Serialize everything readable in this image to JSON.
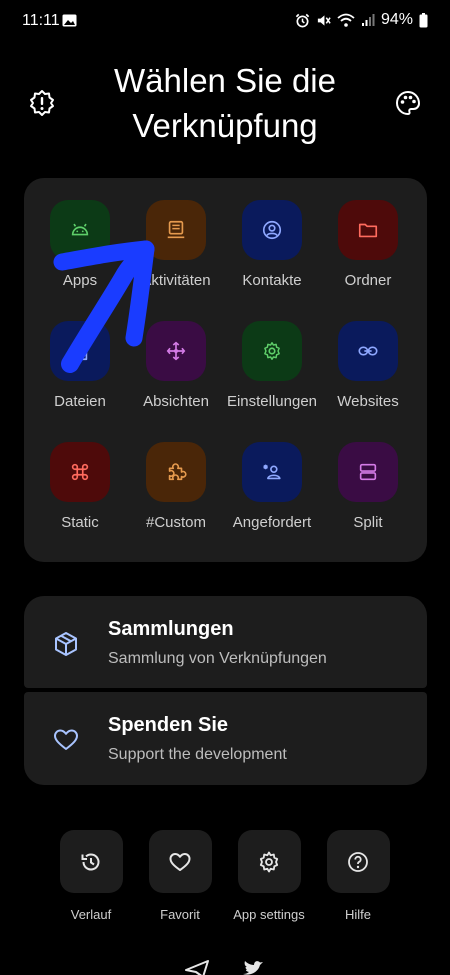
{
  "status_bar": {
    "time": "11:11",
    "battery": "94%"
  },
  "header": {
    "title_line1": "Wählen Sie die",
    "title_line2": "Verknüpfung"
  },
  "grid": [
    {
      "label": "Apps",
      "icon": "android-icon",
      "bg": "#0c3a16",
      "fg": "#5fcf6a"
    },
    {
      "label": "Aktivitäten",
      "icon": "activity-icon",
      "bg": "#4a2608",
      "fg": "#e59a4e"
    },
    {
      "label": "Kontakte",
      "icon": "contact-icon",
      "bg": "#0a1a5c",
      "fg": "#8fa8ff"
    },
    {
      "label": "Ordner",
      "icon": "folder-icon",
      "bg": "#4e0a0a",
      "fg": "#ff6b5e"
    },
    {
      "label": "Dateien",
      "icon": "file-icon",
      "bg": "#0a1a5c",
      "fg": "#8fa8ff"
    },
    {
      "label": "Absichten",
      "icon": "intent-icon",
      "bg": "#3a0c44",
      "fg": "#d47be6"
    },
    {
      "label": "Einstellungen",
      "icon": "gear-icon",
      "bg": "#0c3a16",
      "fg": "#5fcf6a"
    },
    {
      "label": "Websites",
      "icon": "link-icon",
      "bg": "#0a1a5c",
      "fg": "#8fa8ff"
    },
    {
      "label": "Static",
      "icon": "command-icon",
      "bg": "#4e0a0a",
      "fg": "#ff6b5e"
    },
    {
      "label": "#Custom",
      "icon": "puzzle-icon",
      "bg": "#4a2608",
      "fg": "#e59a4e"
    },
    {
      "label": "Angefordert",
      "icon": "person-request-icon",
      "bg": "#0a1a5c",
      "fg": "#8fa8ff"
    },
    {
      "label": "Split",
      "icon": "split-icon",
      "bg": "#3a0c44",
      "fg": "#d47be6"
    }
  ],
  "list": {
    "collections": {
      "title": "Sammlungen",
      "subtitle": "Sammlung von Verknüpfungen"
    },
    "donate": {
      "title": "Spenden Sie",
      "subtitle": "Support the development"
    }
  },
  "bottom": [
    {
      "label": "Verlauf",
      "icon": "history-icon"
    },
    {
      "label": "Favorit",
      "icon": "heart-icon"
    },
    {
      "label": "App settings",
      "icon": "settings-icon"
    },
    {
      "label": "Hilfe",
      "icon": "help-icon"
    }
  ],
  "colors": {
    "background": "#000000",
    "card": "#1d1d1d",
    "accent_icon": "#a9c4ff",
    "annotation_arrow": "#1a3cff"
  }
}
